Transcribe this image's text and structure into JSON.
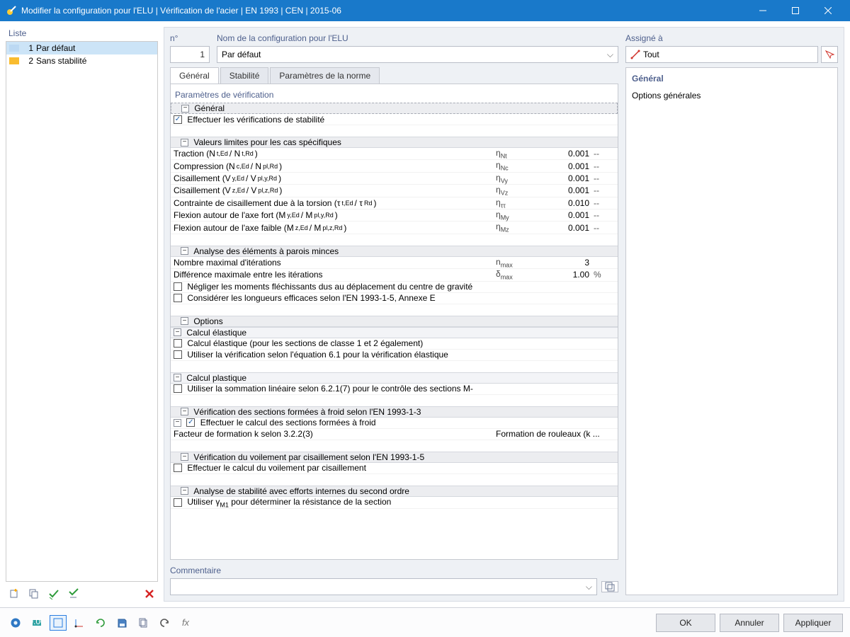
{
  "window": {
    "title": "Modifier la configuration pour l'ELU | Vérification de l'acier | EN 1993 | CEN | 2015-06"
  },
  "left": {
    "heading": "Liste",
    "items": [
      {
        "num": "1",
        "label": "Par défaut",
        "selected": true,
        "color": "#bcd9f3"
      },
      {
        "num": "2",
        "label": "Sans stabilité",
        "selected": false,
        "color": "#f9bc2f"
      }
    ]
  },
  "header": {
    "nr_label": "n°",
    "nr_value": "1",
    "name_label": "Nom de la configuration pour l'ELU",
    "name_value": "Par défaut",
    "assign_label": "Assigné à",
    "assign_value": "Tout"
  },
  "tabs": {
    "t0": "Général",
    "t1": "Stabilité",
    "t2": "Paramètres de la norme"
  },
  "params_title": "Paramètres de vérification",
  "groups": {
    "g_general": "Général",
    "g_general_chk": "Effectuer les vérifications de stabilité",
    "g_limits": "Valeurs limites pour les cas spécifiques",
    "g_thin": "Analyse des éléments à parois minces",
    "g_opts": "Options",
    "g_elastic": "Calcul élastique",
    "g_plastic": "Calcul plastique",
    "g_cold": "Vérification des sections formées à froid selon l'EN 1993-1-3",
    "g_shearb": "Vérification du voilement par cisaillement selon l'EN 1993-1-5",
    "g_stab2": "Analyse de stabilité avec efforts internes du second ordre"
  },
  "limits": [
    {
      "label": "Traction (",
      "sub": "N",
      "subi": "t,Ed",
      "mid": " / N",
      "sub2": "t,Rd",
      "end": ")",
      "sym": "ηNt",
      "val": "0.001",
      "unit": "--"
    },
    {
      "label": "Compression (",
      "sub": "N",
      "subi": "c,Ed",
      "mid": " / N",
      "sub2": "pl,Rd",
      "end": ")",
      "sym": "ηNc",
      "val": "0.001",
      "unit": "--"
    },
    {
      "label": "Cisaillement (",
      "sub": "V",
      "subi": "y,Ed",
      "mid": " / V",
      "sub2": "pl,y,Rd",
      "end": ")",
      "sym": "ηVy",
      "val": "0.001",
      "unit": "--"
    },
    {
      "label": "Cisaillement (",
      "sub": "V",
      "subi": "z,Ed",
      "mid": " / V",
      "sub2": "pl,z,Rd",
      "end": ")",
      "sym": "ηVz",
      "val": "0.001",
      "unit": "--"
    },
    {
      "label": "Contrainte de cisaillement due à la torsion (",
      "sub": "τ",
      "subi": "t,Ed",
      "mid": " / τ",
      "sub2": "Rd",
      "end": ")",
      "sym": "ηττ",
      "val": "0.010",
      "unit": "--"
    },
    {
      "label": "Flexion autour de l'axe fort (",
      "sub": "M",
      "subi": "y,Ed",
      "mid": " / M",
      "sub2": "pl,y,Rd",
      "end": ")",
      "sym": "ηMy",
      "val": "0.001",
      "unit": "--"
    },
    {
      "label": "Flexion autour de l'axe faible (",
      "sub": "M",
      "subi": "z,Ed",
      "mid": " / M",
      "sub2": "pl,z,Rd",
      "end": ")",
      "sym": "ηMz",
      "val": "0.001",
      "unit": "--"
    }
  ],
  "thin": {
    "r1": {
      "label": "Nombre maximal d'itérations",
      "sym": "nmax",
      "val": "3",
      "unit": ""
    },
    "r2": {
      "label": "Différence maximale entre les itérations",
      "sym": "δmax",
      "val": "1.00",
      "unit": "%"
    },
    "c1": "Négliger les moments fléchissants dus au déplacement du centre de gravité",
    "c2": "Considérer les longueurs efficaces selon l'EN 1993-1-5, Annexe E"
  },
  "elastic": {
    "c1": "Calcul élastique (pour les sections de classe 1 et 2 également)",
    "c2": "Utiliser la vérification selon l'équation 6.1 pour la vérification élastique"
  },
  "plastic": {
    "c1": "Utiliser la sommation linéaire selon 6.2.1(7) pour le contrôle des sections M-"
  },
  "cold": {
    "c1": "Effectuer le calcul des sections formées à froid",
    "r2": "Facteur de formation k selon 3.2.2(3)",
    "r2val": "Formation de rouleaux (k ..."
  },
  "shearb": {
    "c1": "Effectuer le calcul du voilement par cisaillement"
  },
  "stab2": {
    "c1": "Utiliser γM1 pour déterminer la résistance de la section"
  },
  "desc": {
    "title": "Général",
    "body": "Options générales"
  },
  "comment_label": "Commentaire",
  "footer": {
    "ok": "OK",
    "cancel": "Annuler",
    "apply": "Appliquer"
  }
}
